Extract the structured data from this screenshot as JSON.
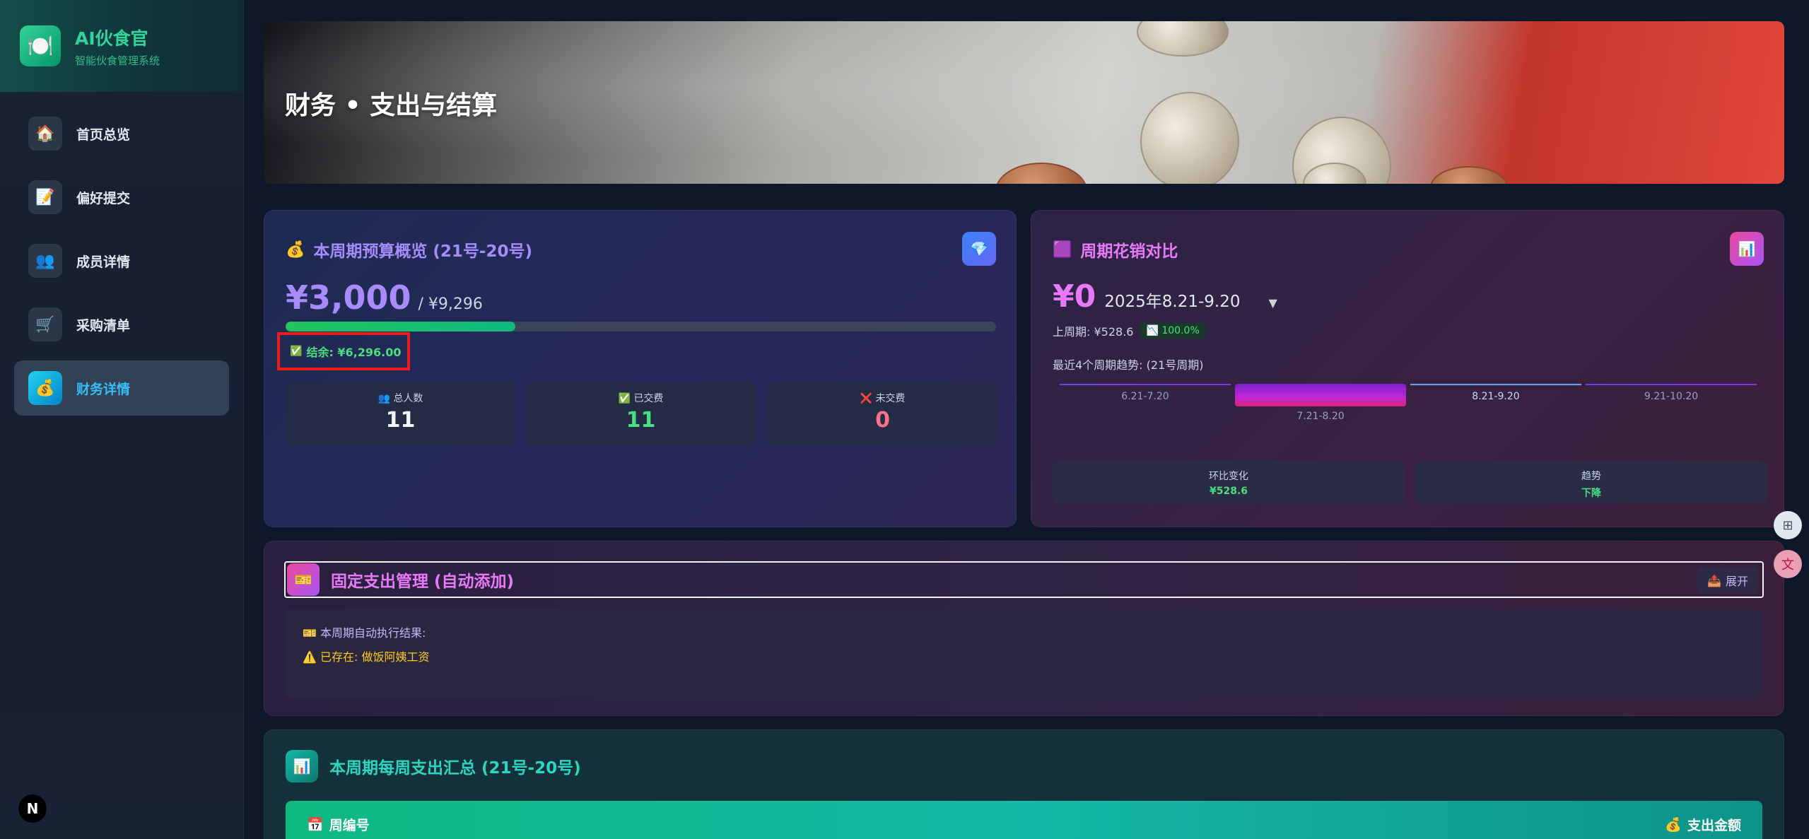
{
  "app": {
    "title": "AI伙食官",
    "subtitle": "智能伙食管理系统",
    "logo_icon": "🍽️"
  },
  "sidebar": {
    "items": [
      {
        "label": "首页总览",
        "icon": "🏠",
        "active": false
      },
      {
        "label": "偏好提交",
        "icon": "📝",
        "active": false
      },
      {
        "label": "成员详情",
        "icon": "👥",
        "active": false
      },
      {
        "label": "采购清单",
        "icon": "🛒",
        "active": false
      },
      {
        "label": "财务详情",
        "icon": "💰",
        "active": true
      }
    ]
  },
  "hero": {
    "title": "财务 • 支出与结算"
  },
  "budget": {
    "icon": "💰",
    "title": "本周期预算概览 (21号-20号)",
    "corner_icon": "💎",
    "amount": "¥3,000",
    "total": "/ ¥9,296",
    "progress_fraction": 0.323,
    "balance": "结余: ¥6,296.00",
    "balance_icon": "✅",
    "stats": [
      {
        "label": "总人数",
        "icon": "👥",
        "value": "11",
        "color": "#f1f5f9"
      },
      {
        "label": "已交费",
        "icon": "✅",
        "value": "11",
        "color": "#4ade80"
      },
      {
        "label": "未交费",
        "icon": "❌",
        "value": "0",
        "color": "#fb7185"
      }
    ]
  },
  "compare": {
    "icon": "🟪",
    "title": "周期花销对比",
    "corner_icon": "📊",
    "amount": "¥0",
    "period": "2025年8.21-9.20",
    "caret": "▼",
    "last_label": "上周期: ¥528.6",
    "pct": "100.0%",
    "pct_icon": "📉",
    "trend_title": "最近4个周期趋势: (21号周期)",
    "trend": [
      {
        "label": "6.21-7.20",
        "value": 0
      },
      {
        "label": "7.21-8.20",
        "value": 528.6
      },
      {
        "label": "8.21-9.20",
        "value": 0,
        "current": true
      },
      {
        "label": "9.21-10.20",
        "value": 0
      }
    ],
    "change_label": "环比变化",
    "change_value": "¥528.6",
    "trend_label": "趋势",
    "trend_value": "下降"
  },
  "fixed": {
    "icon": "🎫",
    "title": "固定支出管理 (自动添加)",
    "expand_label": "展开",
    "expand_icon": "📤",
    "result_title": "本周期自动执行结果:",
    "result_icon": "🎫",
    "warn_icon": "⚠️",
    "warn_text": "已存在: 做饭阿姨工资"
  },
  "weekly": {
    "icon": "📊",
    "title": "本周期每周支出汇总 (21号-20号)",
    "col_week_icon": "📅",
    "col_week": "周编号",
    "col_amount_icon": "💰",
    "col_amount": "支出金额"
  },
  "footer": {
    "badge": "N"
  },
  "colors": {
    "accent": "#a78bfa",
    "success": "#4ade80",
    "danger": "#fb7185",
    "pink": "#e879f9",
    "teal": "#2dd4bf"
  }
}
